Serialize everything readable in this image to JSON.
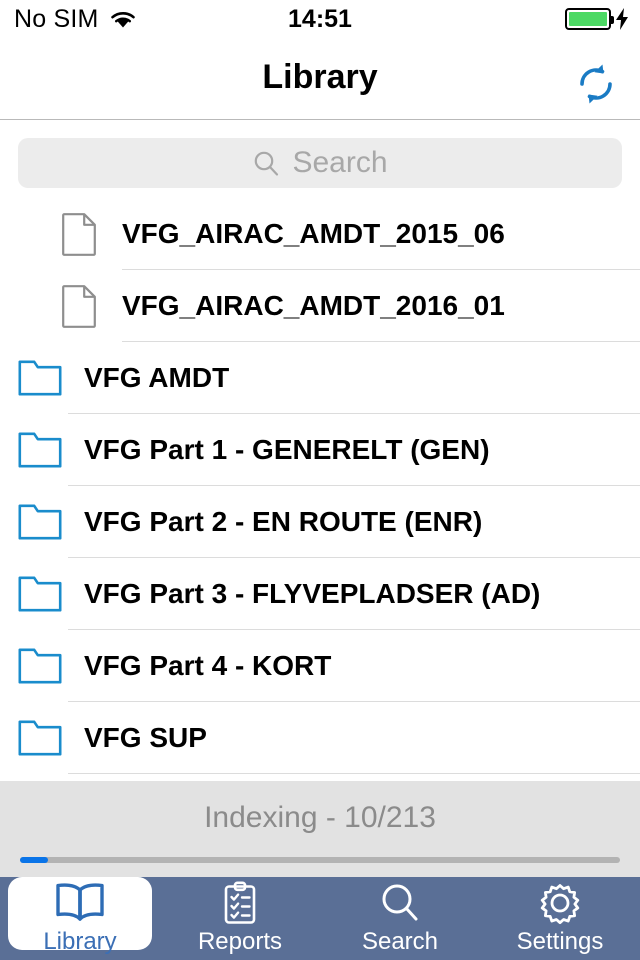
{
  "status_bar": {
    "carrier": "No SIM",
    "wifi_icon": "wifi-icon",
    "time": "14:51",
    "battery_icon": "battery-icon",
    "battery_level_pct": 100,
    "charging_icon": "lightning-bolt-icon",
    "charging": true
  },
  "nav": {
    "title": "Library",
    "refresh_icon": "refresh-icon"
  },
  "search": {
    "placeholder": "Search",
    "value": "",
    "icon": "search-icon"
  },
  "list": {
    "items": [
      {
        "label": "VFG_AIRAC_AMDT_2015_06",
        "type": "file",
        "icon": "document-icon"
      },
      {
        "label": "VFG_AIRAC_AMDT_2016_01",
        "type": "file",
        "icon": "document-icon"
      },
      {
        "label": "VFG AMDT",
        "type": "folder",
        "icon": "folder-icon"
      },
      {
        "label": "VFG Part 1 - GENERELT (GEN)",
        "type": "folder",
        "icon": "folder-icon"
      },
      {
        "label": "VFG Part 2 - EN ROUTE (ENR)",
        "type": "folder",
        "icon": "folder-icon"
      },
      {
        "label": "VFG Part 3 - FLYVEPLADSER (AD)",
        "type": "folder",
        "icon": "folder-icon"
      },
      {
        "label": "VFG Part 4 - KORT",
        "type": "folder",
        "icon": "folder-icon"
      },
      {
        "label": "VFG SUP",
        "type": "folder",
        "icon": "folder-icon"
      }
    ]
  },
  "indexing": {
    "label": "Indexing - 10/213",
    "current": 10,
    "total": 213,
    "progress_pct": 4.7
  },
  "tabs": [
    {
      "label": "Library",
      "icon": "book-icon",
      "active": true
    },
    {
      "label": "Reports",
      "icon": "clipboard-icon",
      "active": false
    },
    {
      "label": "Search",
      "icon": "magnifier-icon",
      "active": false
    },
    {
      "label": "Settings",
      "icon": "gear-icon",
      "active": false
    }
  ],
  "colors": {
    "accent_blue": "#1a7bc4",
    "tab_bar_bg": "#5a6f96",
    "tab_active_text": "#3b6fb5",
    "progress_blue": "#0a74e8",
    "battery_green": "#4cd964",
    "indexing_bg": "#e2e2e2"
  }
}
